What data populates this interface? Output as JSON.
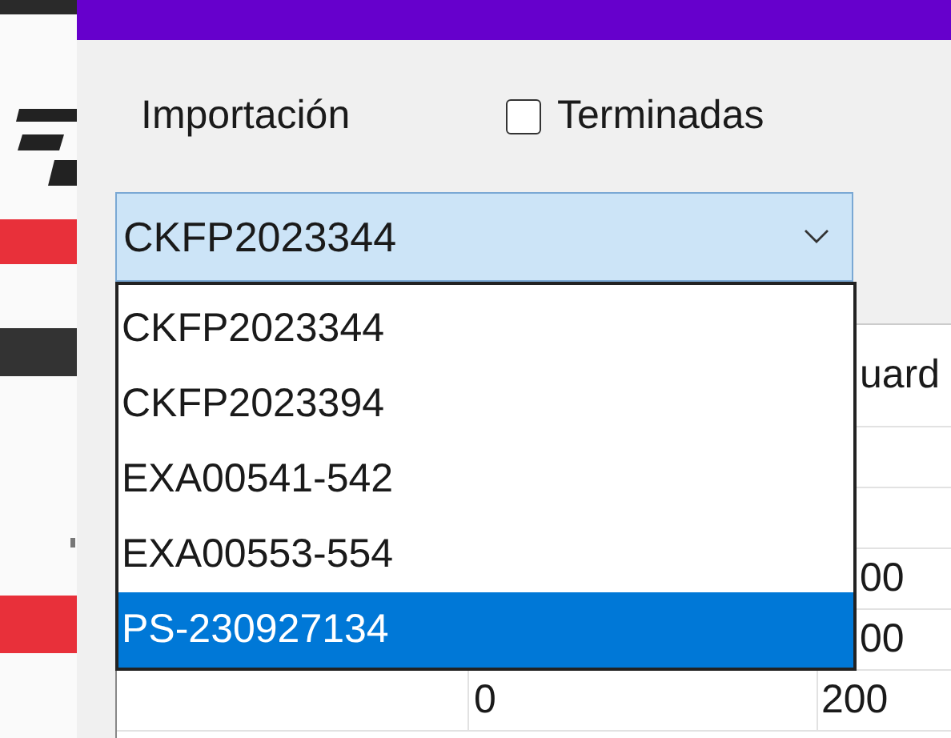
{
  "filter": {
    "label": "Importación",
    "checkbox": {
      "label": "Terminadas",
      "checked": false
    }
  },
  "combo": {
    "value": "CKFP2023344",
    "expanded": true,
    "options": [
      {
        "label": "CKFP2023344",
        "highlighted": false
      },
      {
        "label": "CKFP2023394",
        "highlighted": false
      },
      {
        "label": "EXA00541-542",
        "highlighted": false
      },
      {
        "label": "EXA00553-554",
        "highlighted": false
      },
      {
        "label": "PS-230927134",
        "highlighted": true
      }
    ]
  },
  "grid": {
    "header": {
      "column_3": "uard"
    },
    "rows": [
      {
        "column_2": "",
        "column_3": ""
      },
      {
        "column_2": "",
        "column_3": ""
      },
      {
        "column_2": "",
        "column_3": "00"
      },
      {
        "column_2": "",
        "column_3": "00"
      },
      {
        "column_2": "0",
        "column_3": "200"
      }
    ]
  }
}
